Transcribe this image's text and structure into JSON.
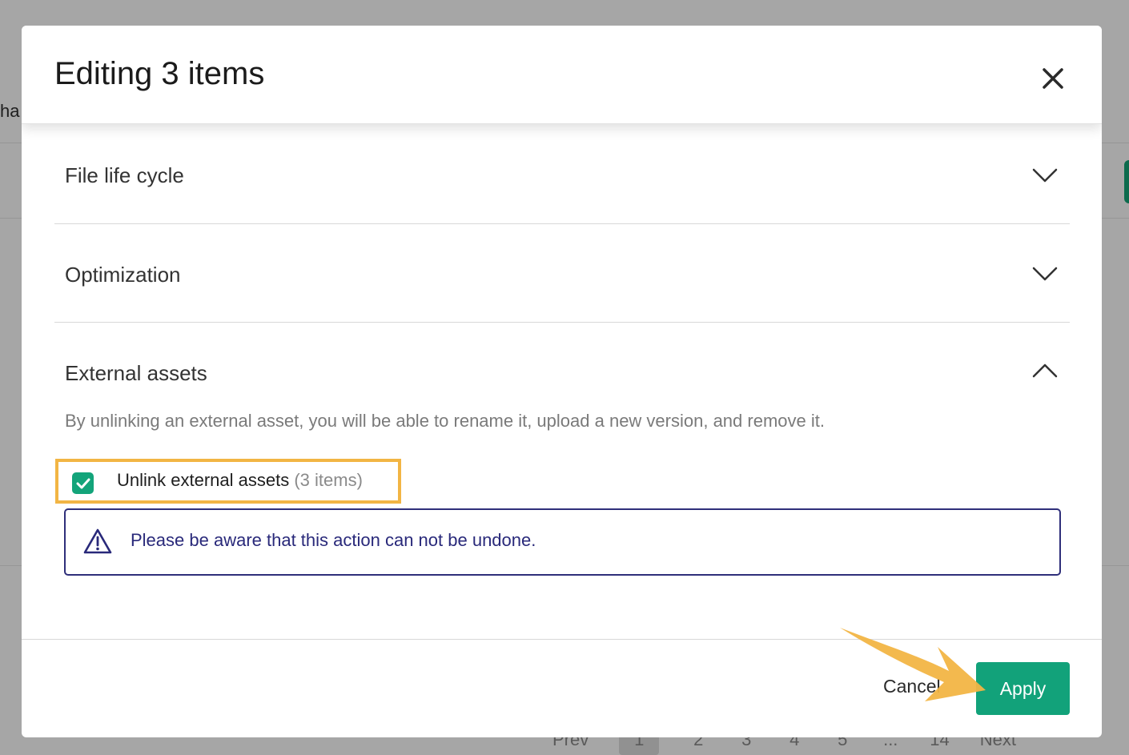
{
  "background": {
    "partial_text": "ha",
    "pagination": [
      "Prev",
      "1",
      "2",
      "3",
      "4",
      "5",
      "...",
      "14",
      "Next"
    ],
    "active_page": "1",
    "accent": "#0d6b4d"
  },
  "modal": {
    "title": "Editing 3 items",
    "close_icon": "close-icon"
  },
  "sections": [
    {
      "label": "File life cycle",
      "expanded": false,
      "icon": "chevron-down-icon"
    },
    {
      "label": "Optimization",
      "expanded": false,
      "icon": "chevron-down-icon"
    },
    {
      "label": "External assets",
      "expanded": true,
      "icon": "chevron-up-icon"
    }
  ],
  "external_assets": {
    "description": "By unlinking an external asset, you will be able to rename it, upload a new version, and remove it.",
    "checkbox_label": "Unlink external assets",
    "checkbox_count": "(3 items)",
    "checked": true,
    "warning_text": "Please be aware that this action can not be undone.",
    "warning_icon": "warning-icon"
  },
  "footer": {
    "cancel_label": "Cancel",
    "apply_label": "Apply"
  },
  "colors": {
    "primary": "#12a27a",
    "highlight": "#f2b544",
    "warning_border": "#2f2f7a"
  }
}
